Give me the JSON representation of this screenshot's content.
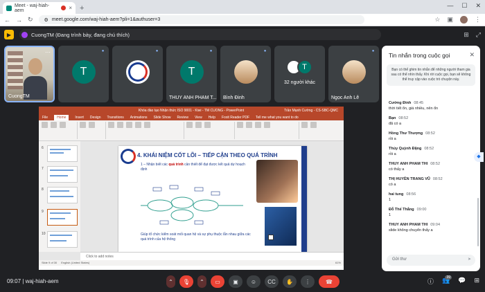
{
  "browser": {
    "tab_title": "Meet - waj-hiah-aem",
    "tab_close": "×",
    "new_tab": "+",
    "url": "meet.google.com/waj-hiah-aem?pli=1&authuser=3"
  },
  "meet": {
    "presenter_text": "CuongTM (Đang trình bày, đang chú thích)"
  },
  "participants": [
    {
      "name": "CuongTM",
      "kind": "self-video"
    },
    {
      "name": "",
      "initial": "T",
      "kind": "initial"
    },
    {
      "name": "",
      "kind": "logo"
    },
    {
      "name": "THUY ANH PHAM T...",
      "initial": "T",
      "kind": "initial"
    },
    {
      "name": "Bình Đinh",
      "kind": "photo"
    },
    {
      "name": "32 người khác",
      "initial": "T",
      "kind": "group"
    },
    {
      "name": "Ngọc Anh Lê",
      "kind": "photo"
    }
  ],
  "slide": {
    "title": "4. KHÁI NIỆM CỐT LÕI – TIẾP CẬN THEO QUÁ TRÌNH",
    "bullet_prefix": "1 – Nhận biết các ",
    "bullet_highlight": "quá trình",
    "bullet_suffix": " cần thiết để đạt được kết quả dự hoạch định",
    "footer": "Giúp tổ chức kiểm soát mối quan hệ và sự phụ thuộc lẫn nhau giữa các quá trình của hệ thống",
    "notes": "Click to add notes"
  },
  "powerpoint": {
    "title": "Khóa đào tạo Nhận thức ISO 9001 - Kiwi - TM CUONG - PowerPoint",
    "user": "Trần Mạnh Cường - CS-SBC-QMC",
    "menu": [
      "File",
      "Home",
      "Insert",
      "Design",
      "Transitions",
      "Animations",
      "Slide Show",
      "Review",
      "View",
      "Help",
      "Foxit Reader PDF",
      "Tell me what you want to do"
    ],
    "status": "Slide 9 of 30",
    "language": "English (United States)",
    "zoom": "61%"
  },
  "chat": {
    "title": "Tin nhắn trong cuộc gọi",
    "notice": "Bạn có thể ghim tin nhắn để những người tham gia sau có thể nhìn thấy. Khi rời cuộc gọi, bạn sẽ không thể truy cập vào cuộc trò chuyện này.",
    "messages": [
      {
        "sender": "Cường Đinh",
        "time": "08:45",
        "text": "thời tiết ổn, giá nhiều, nên ổn"
      },
      {
        "sender": "Bạn",
        "time": "08:52",
        "text": "đã có a"
      },
      {
        "sender": "Hồng Thư Thượng",
        "time": "08:52",
        "text": "rồi a"
      },
      {
        "sender": "Thúy Quỳnh Đặng",
        "time": "08:52",
        "text": "rồi a"
      },
      {
        "sender": "THUY ANH PHAM THI",
        "time": "08:52",
        "text": "có thấy a"
      },
      {
        "sender": "THỊ HUYỀN TRANG VŨ",
        "time": "08:52",
        "text": "có a"
      },
      {
        "sender": "hai tung",
        "time": "08:56",
        "text": "1"
      },
      {
        "sender": "Đỗ Thế Thắng",
        "time": "09:00",
        "text": "1"
      },
      {
        "sender": "THUY ANH PHAM THI",
        "time": "09:04",
        "text": "slide không chuyển thấy a"
      }
    ],
    "input_placeholder": "Gửi thư"
  },
  "bottom": {
    "time": "09:07",
    "separator": "|",
    "meeting_code": "waj-hiah-aem",
    "participant_count": "39"
  }
}
